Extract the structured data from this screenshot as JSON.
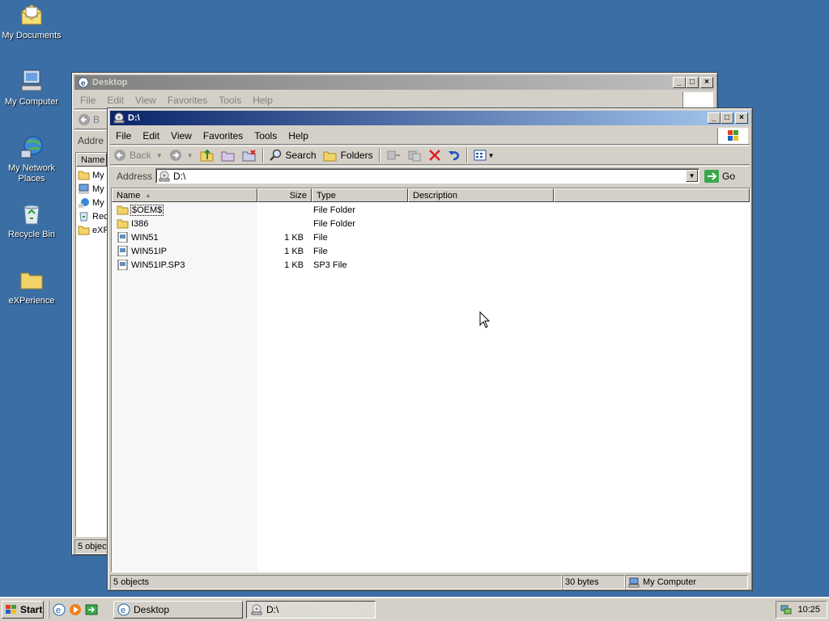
{
  "desktop": {
    "icons": [
      {
        "label": "My Documents"
      },
      {
        "label": "My Computer"
      },
      {
        "label": "My Network Places"
      },
      {
        "label": "Recycle Bin"
      },
      {
        "label": "eXPerience"
      }
    ]
  },
  "back_window": {
    "title": "Desktop",
    "menu": [
      "File",
      "Edit",
      "View",
      "Favorites",
      "Tools",
      "Help"
    ],
    "toolbar_back": "B",
    "address_label": "Addre",
    "col_name": "Name",
    "items": [
      "My",
      "My",
      "My",
      "Rec",
      "eXF"
    ],
    "status": "5 object"
  },
  "front_window": {
    "title": "D:\\",
    "menu": [
      "File",
      "Edit",
      "View",
      "Favorites",
      "Tools",
      "Help"
    ],
    "toolbar": {
      "back": "Back",
      "search": "Search",
      "folders": "Folders"
    },
    "address": {
      "label": "Address",
      "value": "D:\\",
      "go": "Go"
    },
    "columns": [
      "Name",
      "Size",
      "Type",
      "Description"
    ],
    "files": [
      {
        "name": "$OEM$",
        "size": "",
        "type": "File Folder",
        "kind": "folder"
      },
      {
        "name": "I386",
        "size": "",
        "type": "File Folder",
        "kind": "folder"
      },
      {
        "name": "WIN51",
        "size": "1 KB",
        "type": "File",
        "kind": "file"
      },
      {
        "name": "WIN51IP",
        "size": "1 KB",
        "type": "File",
        "kind": "file"
      },
      {
        "name": "WIN51IP.SP3",
        "size": "1 KB",
        "type": "SP3 File",
        "kind": "file"
      }
    ],
    "status": {
      "objects": "5 objects",
      "bytes": "30 bytes",
      "location": "My Computer"
    }
  },
  "taskbar": {
    "start": "Start",
    "tasks": [
      "Desktop",
      "D:\\"
    ],
    "clock": "10:25"
  },
  "colors": {
    "desktop": "#3a6ea5",
    "title_active": "#0a246a",
    "title_inactive": "#808080"
  }
}
